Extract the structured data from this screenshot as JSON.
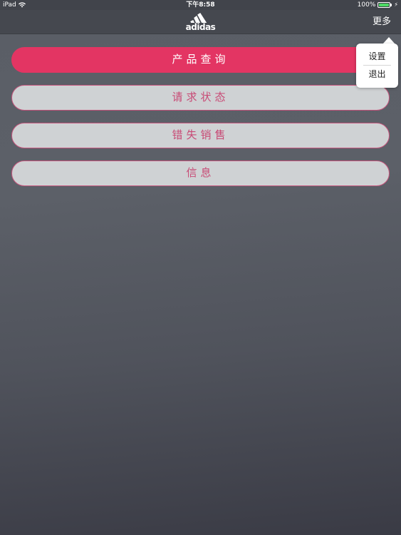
{
  "status_bar": {
    "device": "iPad",
    "time": "下午8:58",
    "battery_percent": "100%",
    "battery_level": 1.0,
    "battery_color": "#4cd964"
  },
  "nav": {
    "logo_text": "adidas",
    "more_label": "更多"
  },
  "menu": {
    "items": [
      {
        "label": "产品查询",
        "active": true
      },
      {
        "label": "请求状态",
        "active": false
      },
      {
        "label": "错失销售",
        "active": false
      },
      {
        "label": "信息",
        "active": false
      }
    ]
  },
  "popover": {
    "items": [
      {
        "label": "设置"
      },
      {
        "label": "退出"
      }
    ]
  },
  "colors": {
    "accent": "#e33563",
    "button_bg": "#cfd2d4",
    "button_text": "#c84a75"
  }
}
